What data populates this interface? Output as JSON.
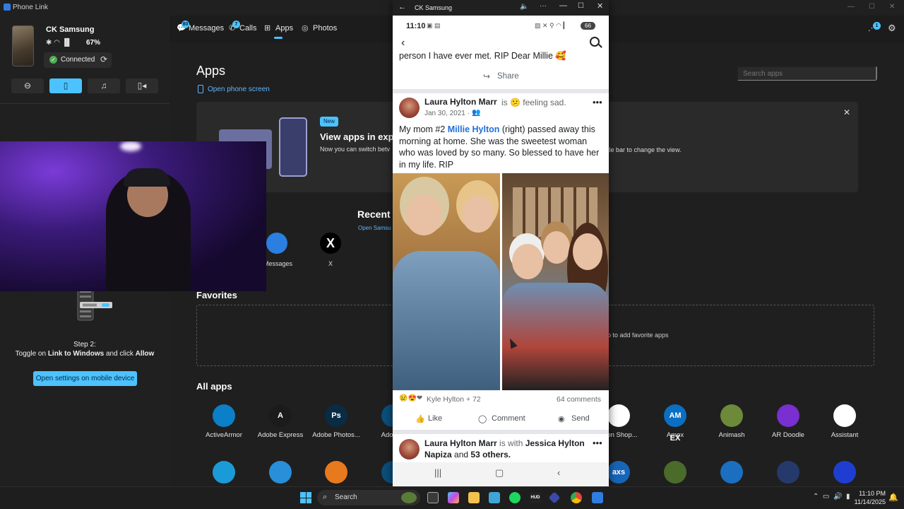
{
  "window": {
    "title": "Phone Link"
  },
  "device": {
    "name": "CK Samsung",
    "battery": "67%",
    "status": "Connected"
  },
  "nav": {
    "messages": "Messages",
    "messages_badge": "80",
    "calls": "Calls",
    "calls_badge": "7",
    "apps": "Apps",
    "photos": "Photos",
    "notif_badge": "1"
  },
  "setup": {
    "step_title": "Step 2:",
    "step_desc_1": "Toggle on ",
    "step_desc_bold": "Link to Windows",
    "step_desc_2": " and click ",
    "step_desc_bold2": "Allow",
    "button": "Open settings on mobile device"
  },
  "apps_page": {
    "title": "Apps",
    "open_phone_screen": "Open phone screen",
    "search_placeholder": "Search apps",
    "banner": {
      "badge": "New",
      "title": "View apps in exp",
      "desc": "Now you can switch betv",
      "desc_tail": "tle bar to change the view."
    },
    "recent_title": "Recent v",
    "recent_sub": "Open Samsu",
    "recent": [
      {
        "label": "Messages"
      },
      {
        "label": "X"
      }
    ],
    "favorites_title": "Favorites",
    "favorites_hint": "p to add favorite apps",
    "allapps_title": "All apps",
    "allapps": [
      {
        "label": "ActiveArmor",
        "glyph": "",
        "color": "#0b7fc7"
      },
      {
        "label": "Adobe Express",
        "glyph": "A",
        "color": "#1b1b1b"
      },
      {
        "label": "Adobe Photos...",
        "glyph": "Ps",
        "color": "#0a2b44"
      },
      {
        "label": "Adobe I",
        "glyph": "",
        "color": "#0b4f7a"
      },
      {
        "label": "azon Shop...",
        "glyph": "",
        "color": "#ffffff"
      },
      {
        "label": "Amex",
        "glyph": "AM EX",
        "color": "#0a6fc2"
      },
      {
        "label": "Animash",
        "glyph": "",
        "color": "#6c8a3a"
      },
      {
        "label": "AR Doodle",
        "glyph": "",
        "color": "#7a2fd0"
      },
      {
        "label": "Assistant",
        "glyph": "",
        "color": "#ffffff"
      }
    ],
    "row2_glyphs": [
      "",
      "",
      "",
      "",
      "axs",
      "",
      "",
      "",
      ""
    ]
  },
  "phone_window": {
    "title": "CK Samsung",
    "status_time": "11:10",
    "status_battery": "66",
    "post1_tail": "person I have ever met. RIP Dear Millie",
    "share_label": "Share",
    "post": {
      "author": "Laura Hylton Marr",
      "feeling": "is 😕 feeling sad.",
      "date": "Jan 30, 2021 ·",
      "text_1": "My mom #2 ",
      "text_link": "Millie Hylton",
      "text_2": " (right) passed away this morning at home.  She was the sweetest woman who was loved by so many.  So blessed to have her in my life.  RIP",
      "reactions": "Kyle Hylton + 72",
      "comments": "64 comments",
      "like": "Like",
      "comment": "Comment",
      "send": "Send"
    },
    "post2": {
      "author": "Laura Hylton Marr",
      "with": " is with ",
      "tagged": "Jessica Hylton Napiza",
      "and": " and ",
      "others": "53 others."
    }
  },
  "taskbar": {
    "search": "Search",
    "time": "11:10 PM",
    "date": "11/14/2025"
  },
  "colors": {
    "accent": "#4cc2ff",
    "link": "#216fdb",
    "connected": "#4caf50"
  }
}
